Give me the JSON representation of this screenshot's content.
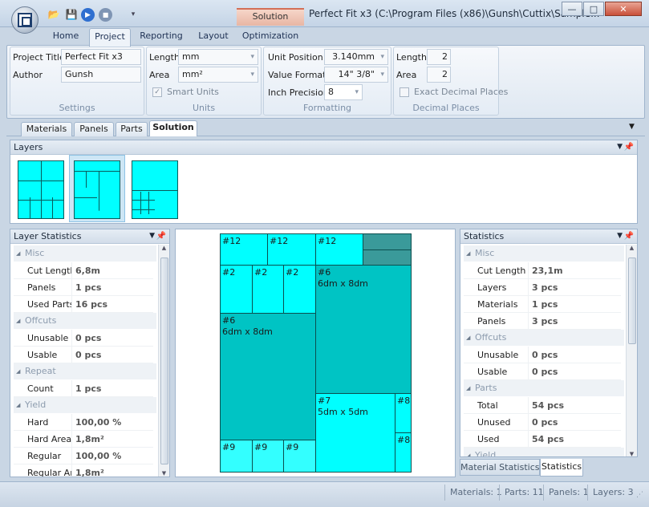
{
  "window": {
    "title": "Perfect Fit x3 (C:\\Program Files (x86)\\Gunsh\\Cuttix\\Sample...",
    "context_tab": "Solution",
    "min_glyph": "—",
    "max_glyph": "□",
    "close_glyph": "✕"
  },
  "ribbon_tabs": [
    "Home",
    "Project",
    "Reporting",
    "Layout",
    "Optimization"
  ],
  "settings": {
    "project_title_label": "Project Title",
    "project_title_value": "Perfect Fit x3",
    "author_label": "Author",
    "author_value": "Gunsh",
    "caption": "Settings"
  },
  "units": {
    "length_label": "Length",
    "length_value": "mm",
    "area_label": "Area",
    "area_value": "mm²",
    "smart_units_label": "Smart Units",
    "caption": "Units"
  },
  "formatting": {
    "unit_position_label": "Unit Position",
    "unit_position_value": "3.140mm",
    "value_format_label": "Value Format",
    "value_format_value": "14\" 3/8\"",
    "inch_precision_label": "Inch Precision",
    "inch_precision_value": "8",
    "caption": "Formatting"
  },
  "decimal_places": {
    "length_label": "Length",
    "length_value": "2",
    "area_label": "Area",
    "area_value": "2",
    "exact_label": "Exact Decimal Places",
    "caption": "Decimal Places"
  },
  "doc_tabs": [
    "Materials",
    "Panels",
    "Parts",
    "Solution"
  ],
  "layers_panel": {
    "title": "Layers"
  },
  "layer_stats": {
    "title": "Layer Statistics",
    "misc": "Misc",
    "cut_length_label": "Cut Length",
    "cut_length": "6,8m",
    "panels_label": "Panels",
    "panels": "1 pcs",
    "used_parts_label": "Used Parts",
    "used_parts": "16 pcs",
    "offcuts": "Offcuts",
    "unusable_label": "Unusable",
    "unusable": "0 pcs",
    "usable_label": "Usable",
    "usable": "0 pcs",
    "repeat": "Repeat",
    "count_label": "Count",
    "count": "1 pcs",
    "yield": "Yield",
    "hard_label": "Hard",
    "hard": "100,00 %",
    "hard_area_label": "Hard Area",
    "hard_area": "1,8m²",
    "regular_label": "Regular",
    "regular": "100,00 %",
    "regular_area_label": "Regular Area",
    "regular_area": "1,8m²"
  },
  "statistics": {
    "title": "Statistics",
    "misc": "Misc",
    "cut_length_label": "Cut Length",
    "cut_length": "23,1m",
    "layers_label": "Layers",
    "layers": "3 pcs",
    "materials_label": "Materials",
    "materials": "1 pcs",
    "panels_label": "Panels",
    "panels": "3 pcs",
    "offcuts": "Offcuts",
    "unusable_label": "Unusable",
    "unusable": "0 pcs",
    "usable_label": "Usable",
    "usable": "0 pcs",
    "parts": "Parts",
    "total_label": "Total",
    "total": "54 pcs",
    "unused_label": "Unused",
    "unused": "0 pcs",
    "used_label": "Used",
    "used": "54 pcs",
    "yield": "Yield",
    "tab_material": "Material Statistics",
    "tab_statistics": "Statistics"
  },
  "layout_parts": {
    "p12": "#12",
    "p2": "#2",
    "p6": "#6",
    "p6_size": "6dm x 8dm",
    "p7": "#7",
    "p7_size": "5dm x 5dm",
    "p8": "#8",
    "p9": "#9"
  },
  "status": {
    "materials": "Materials: 1",
    "parts": "Parts: 11",
    "panels": "Panels: 1",
    "layers": "Layers: 3"
  },
  "colors": {
    "part_cyan": "#00ffff",
    "part_teal": "#00c4c4",
    "offcut_teal": "#3a9a9a"
  }
}
